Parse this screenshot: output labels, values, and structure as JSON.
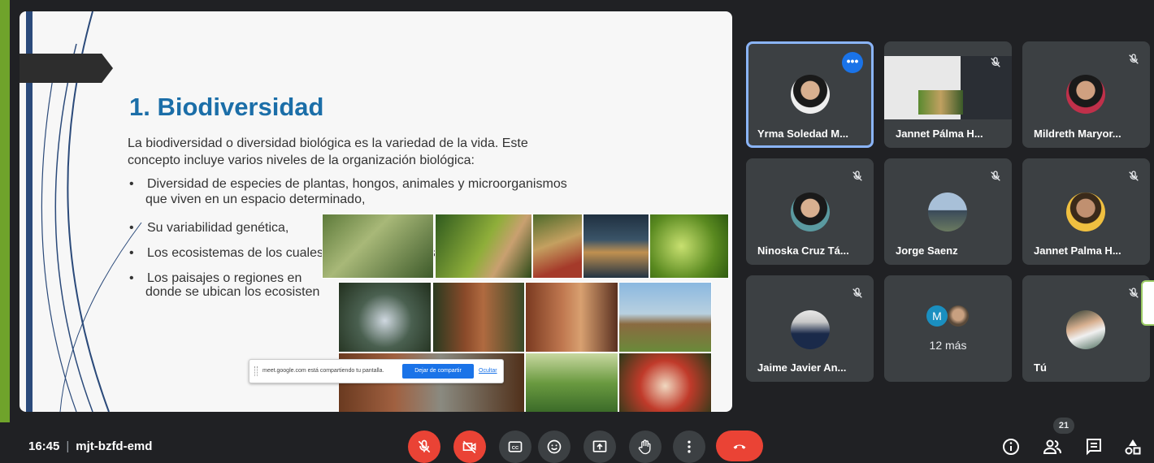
{
  "slide": {
    "title": "1. Biodiversidad",
    "intro": "La biodiversidad o diversidad biológica es la variedad de la vida. Este concepto incluye varios niveles de la organización biológica:",
    "bullets": [
      "Diversidad de especies de plantas, hongos, animales y microorganismos",
      "que viven en un espacio determinado,",
      "Su variabilidad genética,",
      "Los ecosistemas de los cuales forman parte estas especies",
      "Los paisajes o regiones en"
    ],
    "eco_tail": "donde se ubican los ecosisten"
  },
  "share_bar": {
    "message": "meet.google.com está compartiendo tu pantalla.",
    "stop_label": "Dejar de compartir",
    "hide_label": "Ocultar"
  },
  "participants": [
    {
      "name": "Yrma Soledad M...",
      "active": true
    },
    {
      "name": "Jannet Pálma H...",
      "presenting": true
    },
    {
      "name": "Mildreth Maryor..."
    },
    {
      "name": "Ninoska Cruz Tá..."
    },
    {
      "name": "Jorge Saenz"
    },
    {
      "name": "Jannet Palma H..."
    },
    {
      "name": "Jaime Javier An..."
    },
    {
      "name": "12 más",
      "initial": "M"
    },
    {
      "name": "Tú"
    }
  ],
  "meeting": {
    "time": "16:45",
    "separator": "|",
    "code": "mjt-bzfd-emd"
  },
  "controls": [
    "mic-off-icon",
    "camera-off-icon",
    "captions-icon",
    "emoji-icon",
    "present-icon",
    "raise-hand-icon",
    "more-options-icon",
    "hang-up-icon"
  ],
  "right_controls": {
    "people_count": "21",
    "icons": [
      "info-icon",
      "people-icon",
      "chat-icon",
      "activities-icon"
    ]
  },
  "colors": {
    "accent": "#1a73e8",
    "danger": "#ea4335",
    "tile": "#3c4043",
    "background": "#202124"
  }
}
